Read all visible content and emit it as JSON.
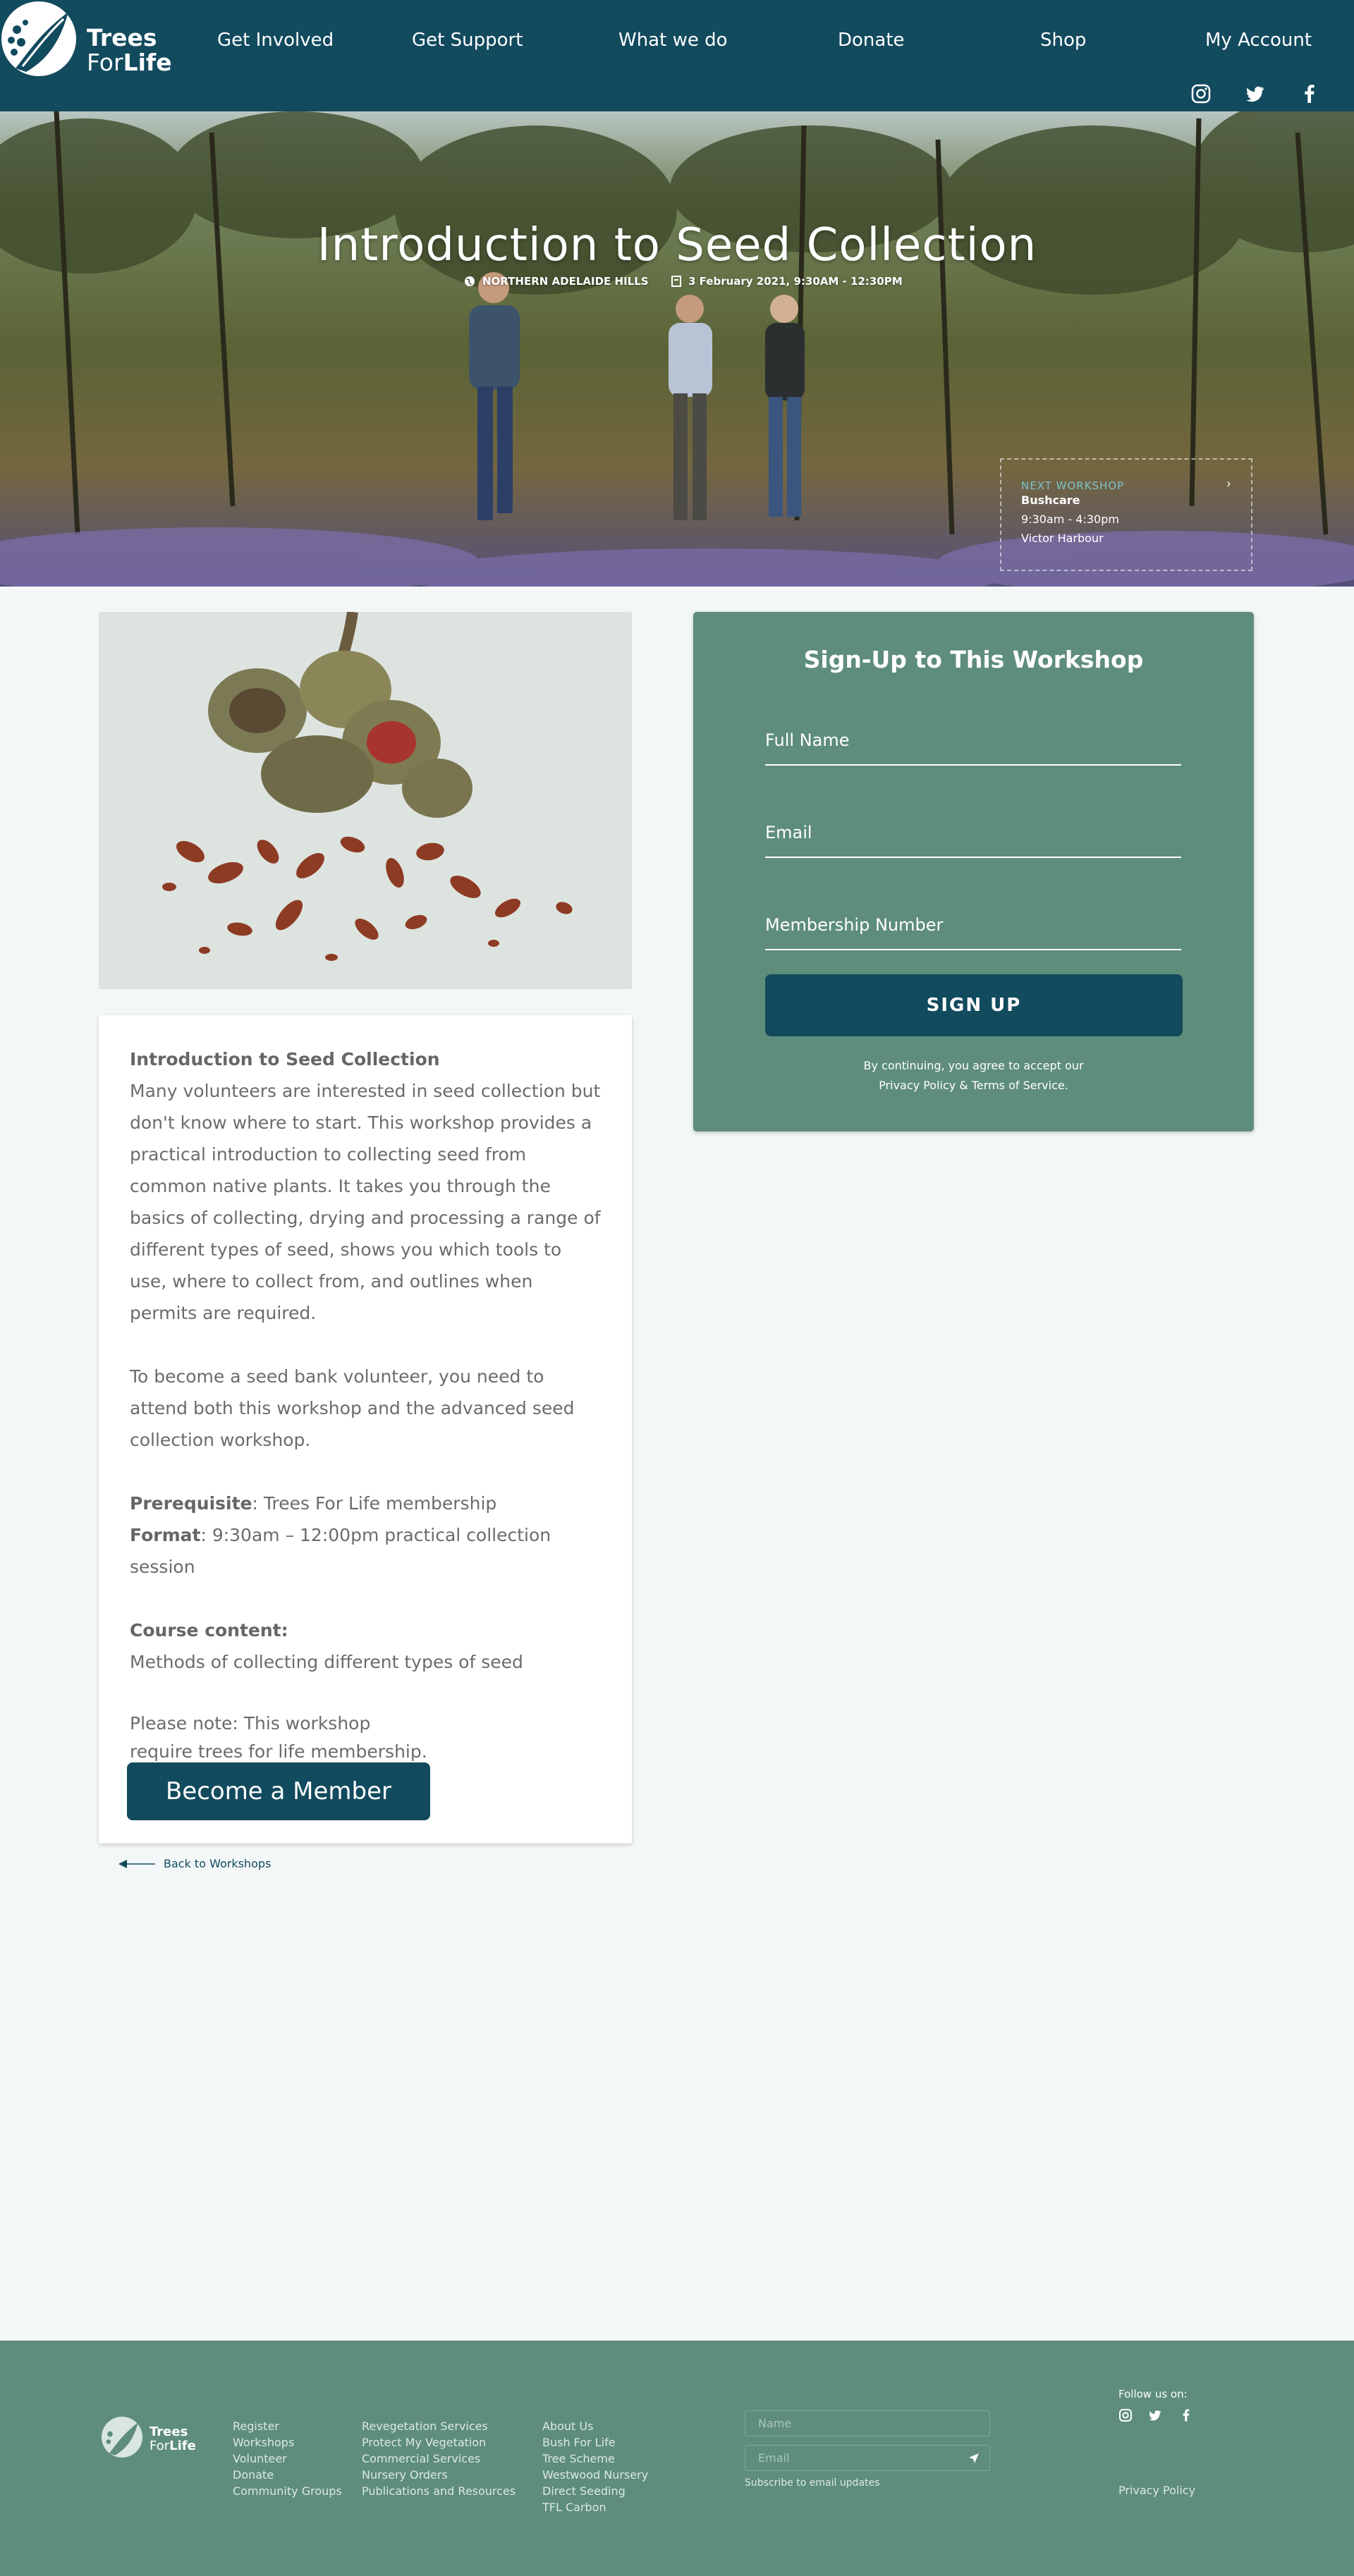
{
  "brand": {
    "line1": "Trees",
    "line2a": "For",
    "line2b": "Life"
  },
  "nav": {
    "items": [
      "Get Involved",
      "Get Support",
      "What we do",
      "Donate",
      "Shop",
      "My Account"
    ],
    "social": [
      "instagram-icon",
      "twitter-icon",
      "facebook-icon"
    ]
  },
  "hero": {
    "title": "Introduction to Seed Collection",
    "location": "NORTHERN ADELAIDE HILLS",
    "datetime": "3 February 2021, 9:30AM - 12:30PM",
    "next": {
      "label": "NEXT WORKSHOP",
      "name": "Bushcare",
      "time": "9:30am - 4:30pm",
      "place": "Victor Harbour"
    }
  },
  "description": {
    "title": "Introduction to Seed Collection",
    "para1": "Many volunteers are interested in seed collection but don't know where to start. This workshop provides a practical introduction to collecting seed from common native plants. It takes you through the basics of collecting, drying and processing a range of different types of seed, shows you which tools to use, where to collect from, and outlines when permits are required.",
    "para2": "To become a seed bank volunteer, you need to attend both this workshop and the advanced seed collection workshop.",
    "prereq_label": "Prerequisite",
    "prereq_value": ": Trees For Life membership",
    "format_label": "Format",
    "format_value": ": 9:30am – 12:00pm practical collection session",
    "course_label": "Course content:",
    "course_value": "Methods of collecting different types of seed",
    "note_line1": "Please note: This workshop",
    "note_line2": "require trees for life membership.",
    "member_button": "Become a Member"
  },
  "back_link": "Back to Workshops",
  "signup": {
    "title": "Sign-Up to This Workshop",
    "fields": [
      "Full Name",
      "Email",
      "Membership Number"
    ],
    "button": "SIGN UP",
    "terms_line1": "By continuing, you agree to accept our",
    "terms_line2": "Privacy Policy & Terms of Service."
  },
  "footer": {
    "col1": [
      "Register",
      "Workshops",
      "Volunteer",
      "Donate",
      "Community Groups"
    ],
    "col2": [
      "Revegetation Services",
      "Protect My Vegetation",
      "Commercial Services",
      "Nursery Orders",
      "Publications and Resources"
    ],
    "col3": [
      "About Us",
      "Bush For Life",
      "Tree Scheme",
      "Westwood Nursery",
      "Direct Seeding",
      "TFL Carbon"
    ],
    "name_placeholder": "Name",
    "email_placeholder": "Email",
    "subscribe": "Subscribe to email updates",
    "follow": "Follow us on:",
    "privacy": "Privacy Policy"
  }
}
